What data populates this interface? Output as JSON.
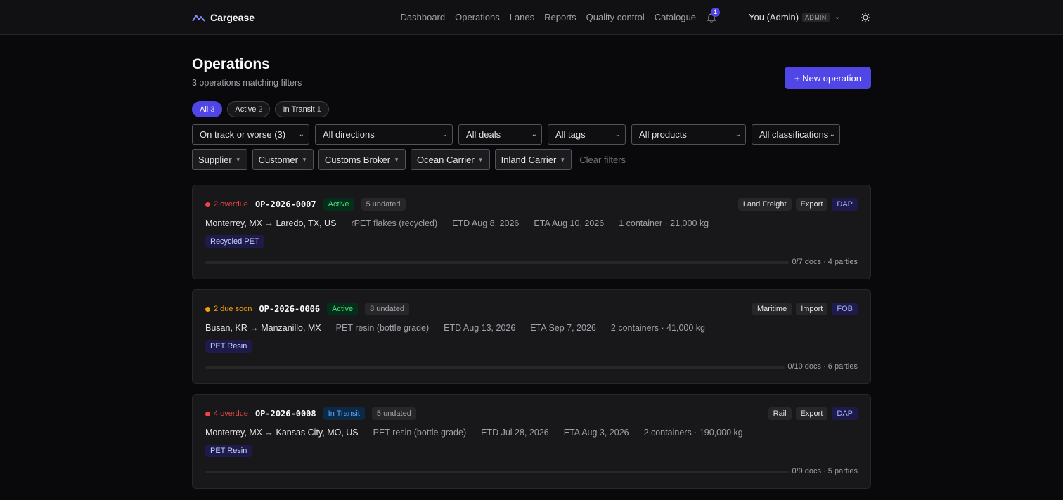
{
  "app": {
    "name": "Cargease"
  },
  "nav": {
    "items": [
      "Dashboard",
      "Operations",
      "Lanes",
      "Reports",
      "Quality control",
      "Catalogue"
    ],
    "notifications": "1",
    "user": "You (Admin)",
    "role": "ADMIN"
  },
  "header": {
    "title": "Operations",
    "subtitle": "3 operations matching filters",
    "new_button": "+ New operation"
  },
  "tabs": [
    {
      "label": "All",
      "count": "3",
      "active": true
    },
    {
      "label": "Active",
      "count": "2",
      "active": false
    },
    {
      "label": "In Transit",
      "count": "1",
      "active": false
    }
  ],
  "filters": {
    "selects": [
      "On track or worse (3)",
      "All directions",
      "All deals",
      "All tags",
      "All products",
      "All classifications"
    ],
    "party_dropdowns": [
      "Supplier",
      "Customer",
      "Customs Broker",
      "Ocean Carrier",
      "Inland Carrier"
    ],
    "clear_label": "Clear filters"
  },
  "operations": [
    {
      "due_text": "2 overdue",
      "due_color": "#ef4444",
      "id": "OP-2026-0007",
      "status": "Active",
      "status_bg": "#052e1a",
      "status_fg": "#4ade80",
      "undated": "5 undated",
      "mode": "Land Freight",
      "direction": "Export",
      "terms": "DAP",
      "route": "Monterrey, MX → Laredo, TX, US",
      "product": "rPET flakes (recycled)",
      "etd": "ETD Aug 8, 2026",
      "eta": "ETA Aug 10, 2026",
      "load": "1 container · 21,000 kg",
      "tag": "Recycled PET",
      "docs": "0/7 docs · 4 parties",
      "progress": 0
    },
    {
      "due_text": "2 due soon",
      "due_color": "#f59e0b",
      "id": "OP-2026-0006",
      "status": "Active",
      "status_bg": "#052e1a",
      "status_fg": "#4ade80",
      "undated": "8 undated",
      "mode": "Maritime",
      "direction": "Import",
      "terms": "FOB",
      "route": "Busan, KR → Manzanillo, MX",
      "product": "PET resin (bottle grade)",
      "etd": "ETD Aug 13, 2026",
      "eta": "ETA Sep 7, 2026",
      "load": "2 containers · 41,000 kg",
      "tag": "PET Resin",
      "docs": "0/10 docs · 6 parties",
      "progress": 0
    },
    {
      "due_text": "4 overdue",
      "due_color": "#ef4444",
      "id": "OP-2026-0008",
      "status": "In Transit",
      "status_bg": "#0c2a45",
      "status_fg": "#60a5fa",
      "undated": "5 undated",
      "mode": "Rail",
      "direction": "Export",
      "terms": "DAP",
      "route": "Monterrey, MX → Kansas City, MO, US",
      "product": "PET resin (bottle grade)",
      "etd": "ETD Jul 28, 2026",
      "eta": "ETA Aug 3, 2026",
      "load": "2 containers · 190,000 kg",
      "tag": "PET Resin",
      "docs": "0/9 docs · 5 parties",
      "progress": 0
    }
  ]
}
